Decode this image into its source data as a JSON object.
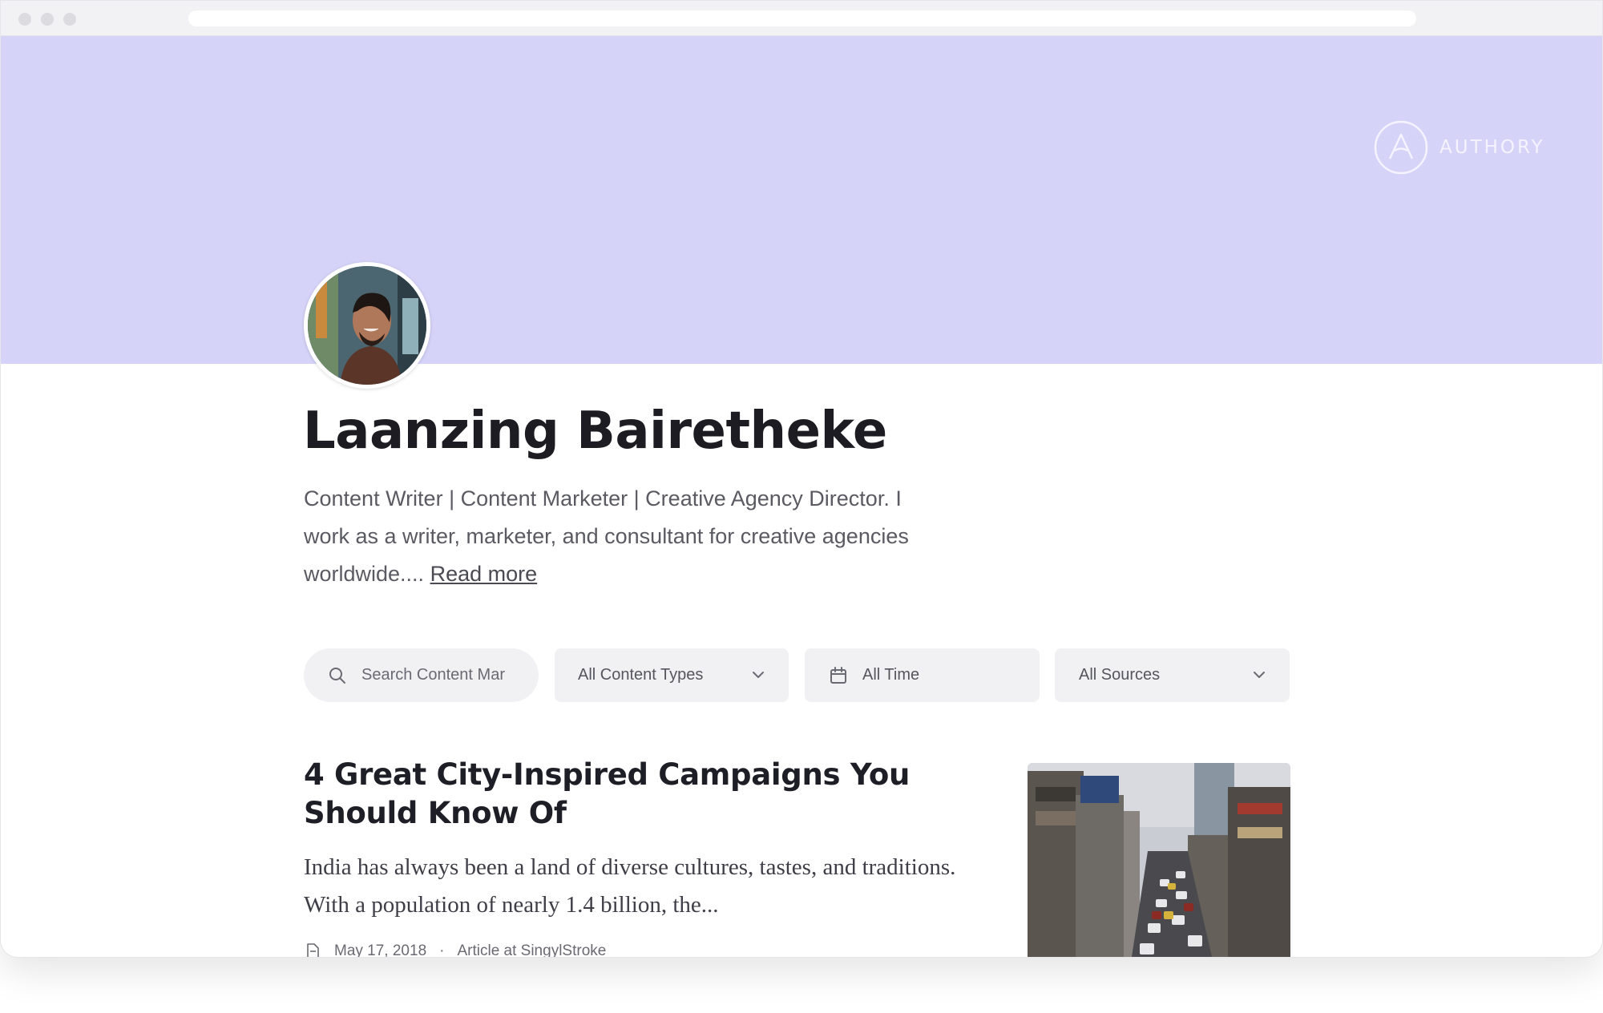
{
  "brand": {
    "name": "AUTHORY"
  },
  "profile": {
    "name": "Laanzing Bairetheke",
    "bio": "Content Writer | Content Marketer | Creative Agency Director. I work as a writer, marketer, and consultant for creative agencies worldwide....",
    "read_more": "Read more"
  },
  "filters": {
    "search_placeholder": "Search Content Mar",
    "content_types": "All Content Types",
    "time": "All Time",
    "sources": "All Sources"
  },
  "article": {
    "title": "4 Great City-Inspired Campaigns You Should Know Of",
    "excerpt": "India has always been a land of diverse cultures, tastes, and traditions. With a population of nearly 1.4 billion, the...",
    "date": "May 17, 2018",
    "source": "Article at SingylStroke"
  },
  "colors": {
    "banner": "#d5d3f8",
    "filter_bg": "#f1f1f4",
    "text_dark": "#1e1e26"
  },
  "icons": [
    "search-icon",
    "chevron-down-icon",
    "calendar-icon",
    "article-icon",
    "authory-logo-icon"
  ]
}
